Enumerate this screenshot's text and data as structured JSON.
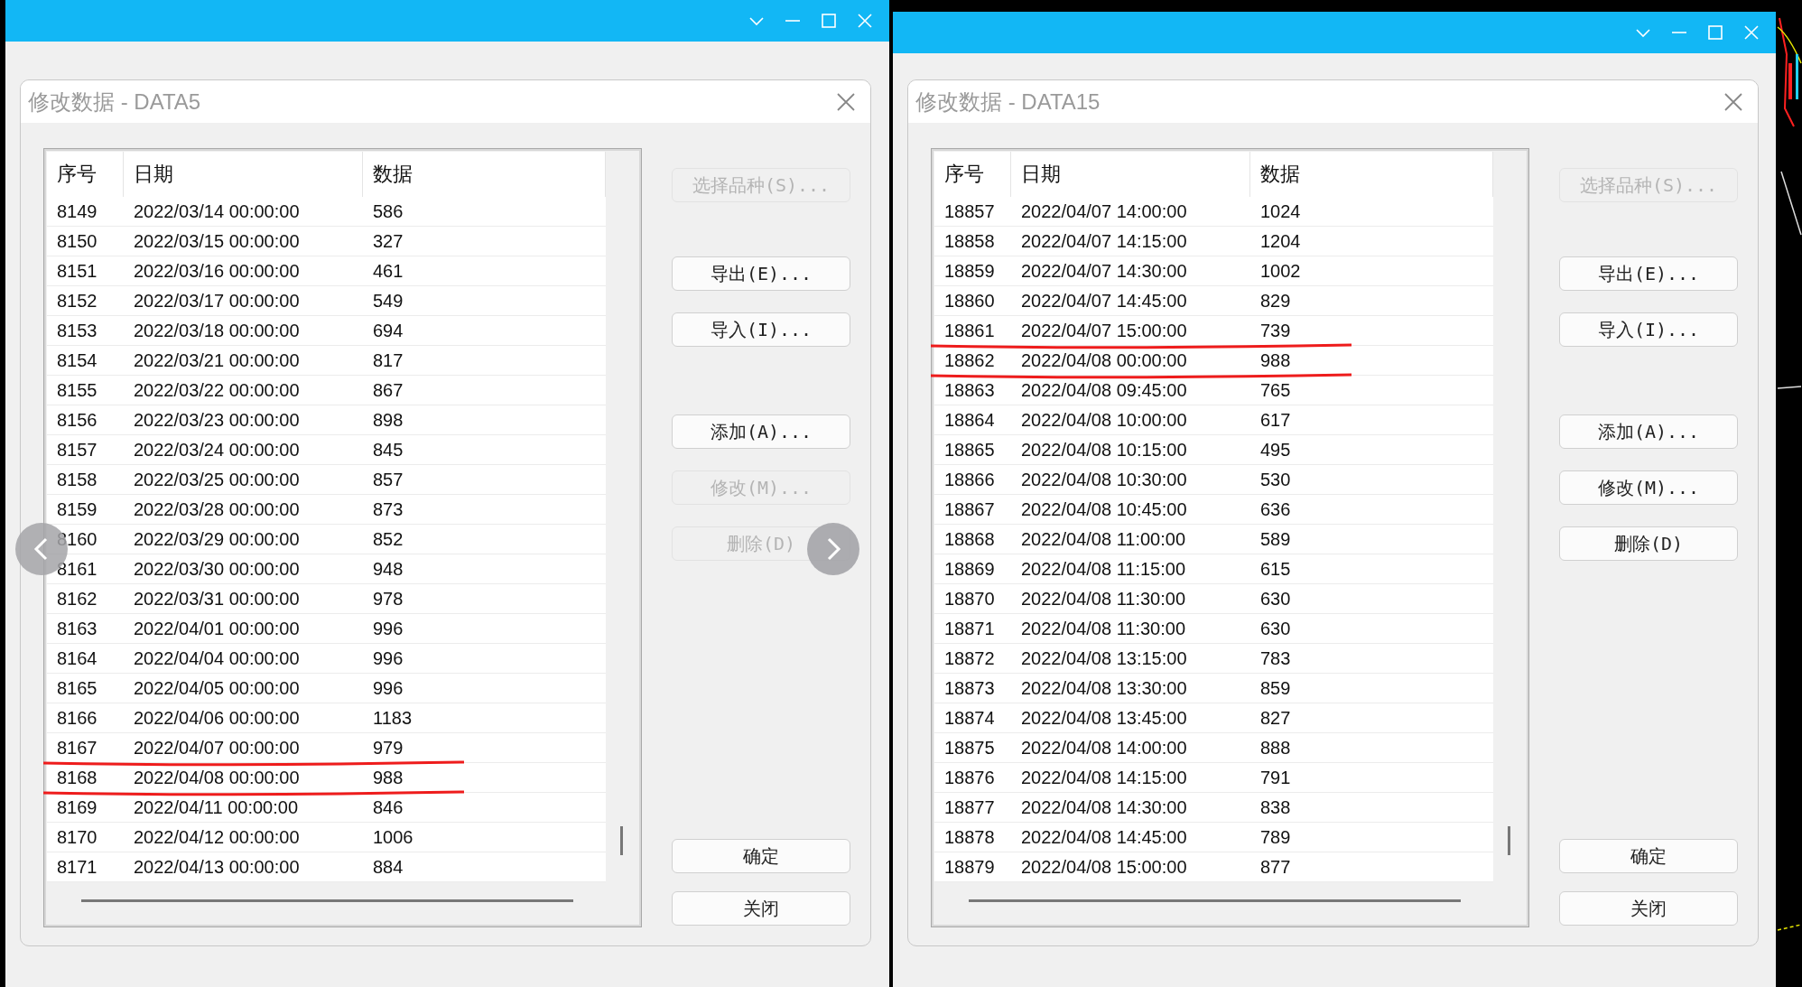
{
  "windows": [
    {
      "dialog_title": "修改数据 - DATA5",
      "slide_arrows": true,
      "columns": [
        "序号",
        "日期",
        "数据"
      ],
      "rows": [
        {
          "cells": [
            "8149",
            "2022/03/14 00:00:00",
            "586"
          ],
          "underlined": false
        },
        {
          "cells": [
            "8150",
            "2022/03/15 00:00:00",
            "327"
          ],
          "underlined": false
        },
        {
          "cells": [
            "8151",
            "2022/03/16 00:00:00",
            "461"
          ],
          "underlined": false
        },
        {
          "cells": [
            "8152",
            "2022/03/17 00:00:00",
            "549"
          ],
          "underlined": false
        },
        {
          "cells": [
            "8153",
            "2022/03/18 00:00:00",
            "694"
          ],
          "underlined": false
        },
        {
          "cells": [
            "8154",
            "2022/03/21 00:00:00",
            "817"
          ],
          "underlined": false
        },
        {
          "cells": [
            "8155",
            "2022/03/22 00:00:00",
            "867"
          ],
          "underlined": false
        },
        {
          "cells": [
            "8156",
            "2022/03/23 00:00:00",
            "898"
          ],
          "underlined": false
        },
        {
          "cells": [
            "8157",
            "2022/03/24 00:00:00",
            "845"
          ],
          "underlined": false
        },
        {
          "cells": [
            "8158",
            "2022/03/25 00:00:00",
            "857"
          ],
          "underlined": false
        },
        {
          "cells": [
            "8159",
            "2022/03/28 00:00:00",
            "873"
          ],
          "underlined": false
        },
        {
          "cells": [
            "8160",
            "2022/03/29 00:00:00",
            "852"
          ],
          "underlined": false
        },
        {
          "cells": [
            "8161",
            "2022/03/30 00:00:00",
            "948"
          ],
          "underlined": false
        },
        {
          "cells": [
            "8162",
            "2022/03/31 00:00:00",
            "978"
          ],
          "underlined": false
        },
        {
          "cells": [
            "8163",
            "2022/04/01 00:00:00",
            "996"
          ],
          "underlined": false
        },
        {
          "cells": [
            "8164",
            "2022/04/04 00:00:00",
            "996"
          ],
          "underlined": false
        },
        {
          "cells": [
            "8165",
            "2022/04/05 00:00:00",
            "996"
          ],
          "underlined": false
        },
        {
          "cells": [
            "8166",
            "2022/04/06 00:00:00",
            "1183"
          ],
          "underlined": false
        },
        {
          "cells": [
            "8167",
            "2022/04/07 00:00:00",
            "979"
          ],
          "underlined": true
        },
        {
          "cells": [
            "8168",
            "2022/04/08 00:00:00",
            "988"
          ],
          "underlined": true
        },
        {
          "cells": [
            "8169",
            "2022/04/11 00:00:00",
            "846"
          ],
          "underlined": false
        },
        {
          "cells": [
            "8170",
            "2022/04/12 00:00:00",
            "1006"
          ],
          "underlined": false
        },
        {
          "cells": [
            "8171",
            "2022/04/13 00:00:00",
            "884"
          ],
          "underlined": false
        }
      ],
      "button_groups": [
        [
          {
            "label": "选择品种(S)...",
            "disabled": true
          }
        ],
        [
          {
            "label": "导出(E)...",
            "disabled": false
          },
          {
            "label": "导入(I)...",
            "disabled": false
          }
        ],
        [
          {
            "label": "添加(A)...",
            "disabled": false
          },
          {
            "label": "修改(M)...",
            "disabled": true
          },
          {
            "label": "删除(D)",
            "disabled": true
          }
        ],
        [
          {
            "label": "确定",
            "disabled": false
          },
          {
            "label": "关闭",
            "disabled": false
          }
        ]
      ]
    },
    {
      "dialog_title": "修改数据 - DATA15",
      "slide_arrows": false,
      "columns": [
        "序号",
        "日期",
        "数据"
      ],
      "rows": [
        {
          "cells": [
            "18857",
            "2022/04/07 14:00:00",
            "1024"
          ],
          "underlined": false
        },
        {
          "cells": [
            "18858",
            "2022/04/07 14:15:00",
            "1204"
          ],
          "underlined": false
        },
        {
          "cells": [
            "18859",
            "2022/04/07 14:30:00",
            "1002"
          ],
          "underlined": false
        },
        {
          "cells": [
            "18860",
            "2022/04/07 14:45:00",
            "829"
          ],
          "underlined": false
        },
        {
          "cells": [
            "18861",
            "2022/04/07 15:00:00",
            "739"
          ],
          "underlined": true
        },
        {
          "cells": [
            "18862",
            "2022/04/08 00:00:00",
            "988"
          ],
          "underlined": true
        },
        {
          "cells": [
            "18863",
            "2022/04/08 09:45:00",
            "765"
          ],
          "underlined": false
        },
        {
          "cells": [
            "18864",
            "2022/04/08 10:00:00",
            "617"
          ],
          "underlined": false
        },
        {
          "cells": [
            "18865",
            "2022/04/08 10:15:00",
            "495"
          ],
          "underlined": false
        },
        {
          "cells": [
            "18866",
            "2022/04/08 10:30:00",
            "530"
          ],
          "underlined": false
        },
        {
          "cells": [
            "18867",
            "2022/04/08 10:45:00",
            "636"
          ],
          "underlined": false
        },
        {
          "cells": [
            "18868",
            "2022/04/08 11:00:00",
            "589"
          ],
          "underlined": false
        },
        {
          "cells": [
            "18869",
            "2022/04/08 11:15:00",
            "615"
          ],
          "underlined": false
        },
        {
          "cells": [
            "18870",
            "2022/04/08 11:30:00",
            "630"
          ],
          "underlined": false
        },
        {
          "cells": [
            "18871",
            "2022/04/08 11:30:00",
            "630"
          ],
          "underlined": false
        },
        {
          "cells": [
            "18872",
            "2022/04/08 13:15:00",
            "783"
          ],
          "underlined": false
        },
        {
          "cells": [
            "18873",
            "2022/04/08 13:30:00",
            "859"
          ],
          "underlined": false
        },
        {
          "cells": [
            "18874",
            "2022/04/08 13:45:00",
            "827"
          ],
          "underlined": false
        },
        {
          "cells": [
            "18875",
            "2022/04/08 14:00:00",
            "888"
          ],
          "underlined": false
        },
        {
          "cells": [
            "18876",
            "2022/04/08 14:15:00",
            "791"
          ],
          "underlined": false
        },
        {
          "cells": [
            "18877",
            "2022/04/08 14:30:00",
            "838"
          ],
          "underlined": false
        },
        {
          "cells": [
            "18878",
            "2022/04/08 14:45:00",
            "789"
          ],
          "underlined": false
        },
        {
          "cells": [
            "18879",
            "2022/04/08 15:00:00",
            "877"
          ],
          "underlined": false
        }
      ],
      "button_groups": [
        [
          {
            "label": "选择品种(S)...",
            "disabled": true
          }
        ],
        [
          {
            "label": "导出(E)...",
            "disabled": false
          },
          {
            "label": "导入(I)...",
            "disabled": false
          }
        ],
        [
          {
            "label": "添加(A)...",
            "disabled": false
          },
          {
            "label": "修改(M)...",
            "disabled": false
          },
          {
            "label": "删除(D)",
            "disabled": false
          }
        ],
        [
          {
            "label": "确定",
            "disabled": false
          },
          {
            "label": "关闭",
            "disabled": false
          }
        ]
      ]
    }
  ]
}
